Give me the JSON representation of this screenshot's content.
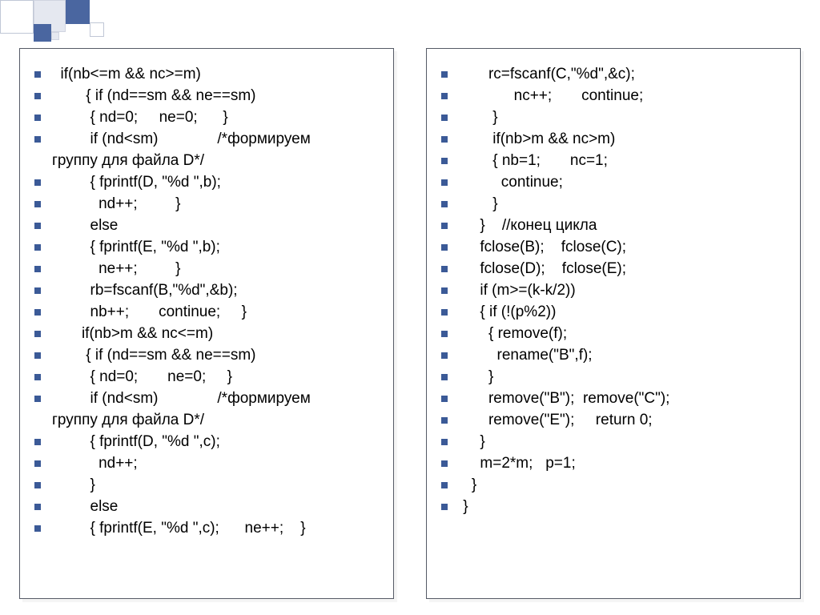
{
  "left": {
    "lines": [
      "  if(nb<=m && nc>=m)",
      "        { if (nd==sm && ne==sm)",
      "         { nd=0;     ne=0;      }",
      "         if (nd<sm)              /*формируем",
      "         { fprintf(D, \"%d \",b);",
      "           nd++;         }",
      "         else",
      "         { fprintf(E, \"%d \",b);",
      "           ne++;         }",
      "         rb=fscanf(B,\"%d\",&b);",
      "         nb++;       continue;     }",
      "       if(nb>m && nc<=m)",
      "        { if (nd==sm && ne==sm)",
      "         { nd=0;       ne=0;     }",
      "         if (nd<sm)              /*формируем",
      "         { fprintf(D, \"%d \",c);",
      "           nd++;",
      "         }",
      "         else",
      "         { fprintf(E, \"%d \",c);      ne++;    }"
    ],
    "wrap_text": "группу для файла D*/"
  },
  "right": {
    "lines": [
      "       rc=fscanf(C,\"%d\",&c);",
      "             nc++;       continue;",
      "        }",
      "        if(nb>m && nc>m)",
      "        { nb=1;       nc=1;",
      "          continue;",
      "        }",
      "     }    //конец цикла",
      "     fclose(B);    fclose(C);",
      "     fclose(D);    fclose(E);",
      "     if (m>=(k-k/2))",
      "     { if (!(p%2))",
      "       { remove(f);",
      "         rename(\"B\",f);",
      "       }",
      "       remove(\"B\");  remove(\"C\");",
      "       remove(\"E\");     return 0;",
      "     }",
      "     m=2*m;   p=1;",
      "   }",
      " }"
    ]
  }
}
